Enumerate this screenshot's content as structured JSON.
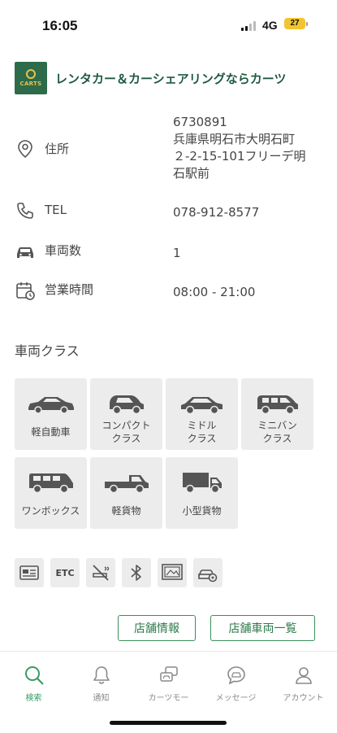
{
  "status": {
    "time": "16:05",
    "network": "4G",
    "battery": "27"
  },
  "brand": {
    "logo_text": "CARTS",
    "name": "レンタカー＆カーシェアリングならカーツ",
    "color": "#2d6b4a"
  },
  "info": {
    "address": {
      "icon": "location-pin-icon",
      "label": "住所",
      "lines": [
        "6730891",
        "兵庫県明石市大明石町",
        "２-2-15-101フリーデ明",
        "石駅前"
      ]
    },
    "tel": {
      "icon": "phone-icon",
      "label": "TEL",
      "value": "078-912-8577"
    },
    "vehicles": {
      "icon": "car-icon",
      "label": "車両数",
      "value": "1"
    },
    "hours": {
      "icon": "calendar-clock-icon",
      "label": "営業時間",
      "value": "08:00 - 21:00"
    }
  },
  "vehicle_class": {
    "title": "車両クラス",
    "items": [
      {
        "name": "軽自動車",
        "icon": "kei-car-icon"
      },
      {
        "name": "コンパクトクラス",
        "line1": "コンパクト",
        "line2": "クラス",
        "icon": "compact-car-icon"
      },
      {
        "name": "ミドルクラス",
        "line1": "ミドル",
        "line2": "クラス",
        "icon": "middle-car-icon"
      },
      {
        "name": "ミニバンクラス",
        "line1": "ミニバン",
        "line2": "クラス",
        "icon": "minivan-icon"
      },
      {
        "name": "ワンボックス",
        "icon": "one-box-van-icon"
      },
      {
        "name": "軽貨物",
        "icon": "light-truck-icon"
      },
      {
        "name": "小型貨物",
        "icon": "small-truck-icon"
      }
    ]
  },
  "features": [
    {
      "icon": "etc-card-icon"
    },
    {
      "icon": "etc-text-icon",
      "text": "ETC"
    },
    {
      "icon": "no-smoking-icon"
    },
    {
      "icon": "bluetooth-icon"
    },
    {
      "icon": "navigation-screen-icon"
    },
    {
      "icon": "car-settings-icon"
    }
  ],
  "buttons": {
    "store_info": "店舗情報",
    "store_vehicles": "店舗車両一覧"
  },
  "tabs": [
    {
      "label": "検索",
      "icon": "search-icon",
      "active": true
    },
    {
      "label": "通知",
      "icon": "bell-icon",
      "active": false
    },
    {
      "label": "カーツモー",
      "icon": "chat-car-icon",
      "active": false
    },
    {
      "label": "メッセージ",
      "icon": "message-icon",
      "active": false
    },
    {
      "label": "アカウント",
      "icon": "account-icon",
      "active": false
    }
  ],
  "colors": {
    "accent": "#3a9a66",
    "tile": "#ececec"
  }
}
